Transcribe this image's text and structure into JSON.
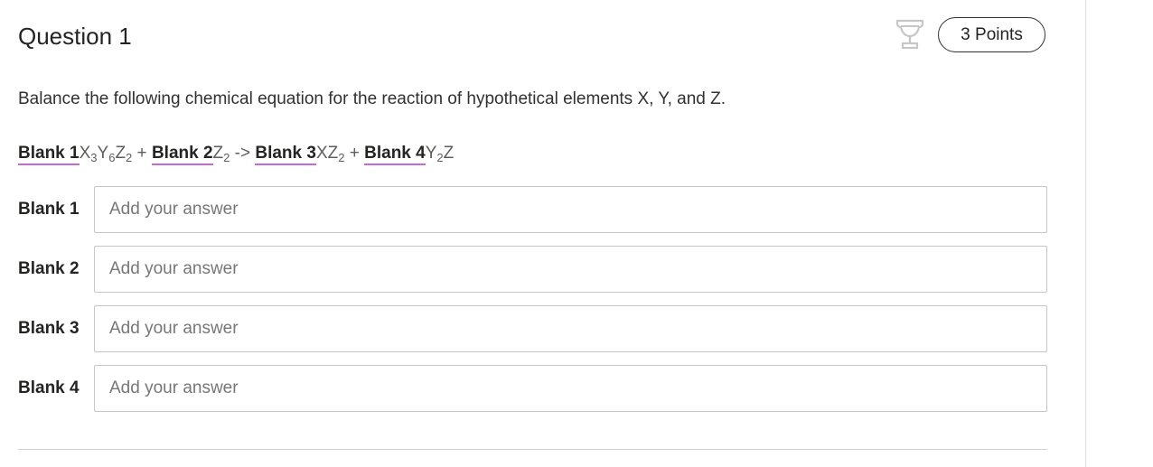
{
  "question": {
    "title": "Question 1",
    "points": "3 Points",
    "prompt": "Balance the following chemical equation for the reaction of hypothetical elements X, Y, and Z."
  },
  "equation": {
    "blank1": "Blank 1",
    "term1_a": "X",
    "term1_a_sub": "3",
    "term1_b": "Y",
    "term1_b_sub": "6",
    "term1_c": "Z",
    "term1_c_sub": "2",
    "plus1": " + ",
    "blank2": "Blank 2",
    "term2_a": "Z",
    "term2_a_sub": "2",
    "arrow": " -> ",
    "blank3": "Blank 3",
    "term3_a": "XZ",
    "term3_a_sub": "2",
    "plus2": " + ",
    "blank4": "Blank 4",
    "term4_a": "Y",
    "term4_a_sub": "2",
    "term4_b": "Z"
  },
  "blanks": [
    {
      "label": "Blank 1",
      "value": "",
      "placeholder": "Add your answer"
    },
    {
      "label": "Blank 2",
      "value": "",
      "placeholder": "Add your answer"
    },
    {
      "label": "Blank 3",
      "value": "",
      "placeholder": "Add your answer"
    },
    {
      "label": "Blank 4",
      "value": "",
      "placeholder": "Add your answer"
    }
  ],
  "icons": {
    "trophy": "trophy-icon"
  },
  "colors": {
    "blank_underline": "#c768d8",
    "text": "#323130"
  }
}
